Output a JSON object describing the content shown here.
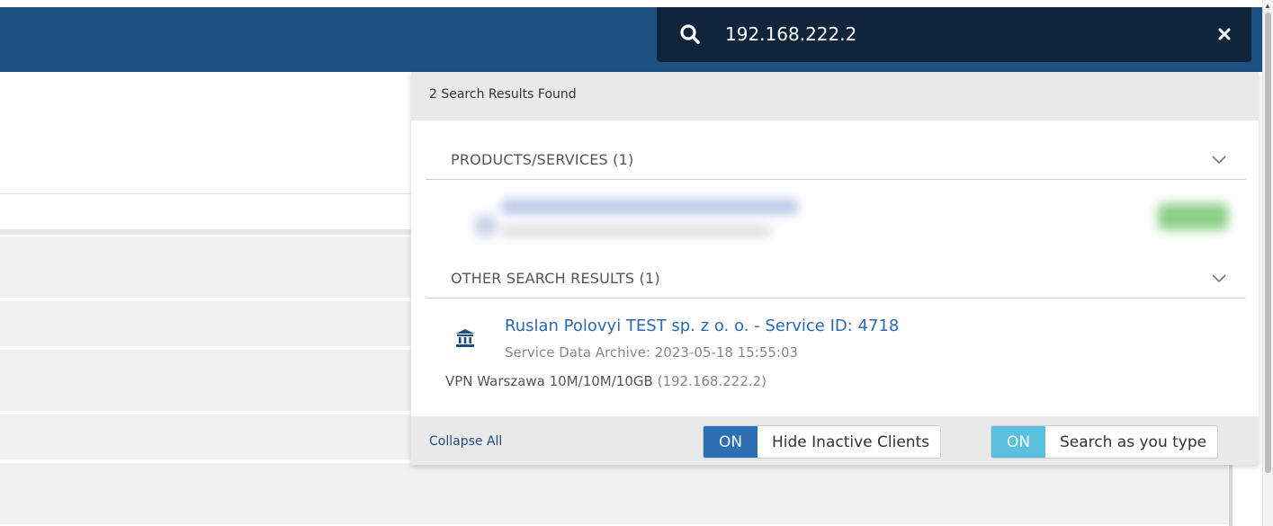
{
  "colors": {
    "topbar": "#1d4f80",
    "search_bg": "#10243b",
    "link": "#2a6ab3",
    "toggle_hide_on": "#2d6fb5",
    "toggle_search_on": "#5bc0de"
  },
  "search": {
    "value": "192.168.222.2",
    "icon": "search-icon",
    "clear_icon": "close-icon"
  },
  "results": {
    "count_text": "2 Search Results Found",
    "sections": [
      {
        "title": "PRODUCTS/SERVICES (1)",
        "icon": "chevron-down-icon"
      },
      {
        "title": "OTHER SEARCH RESULTS (1)",
        "icon": "chevron-down-icon"
      }
    ],
    "other_result": {
      "icon": "bank-icon",
      "title": "Ruslan Polovyi TEST sp. z o. o. - Service ID: 4718",
      "subtitle": "Service Data Archive: 2023-05-18 15:55:03",
      "service_name": "VPN Warszawa 10M/10M/10GB",
      "service_ip": "(192.168.222.2)"
    }
  },
  "footer": {
    "collapse_label": "Collapse All",
    "toggles": [
      {
        "state": "ON",
        "label": "Hide Inactive Clients"
      },
      {
        "state": "ON",
        "label": "Search as you type"
      }
    ]
  }
}
